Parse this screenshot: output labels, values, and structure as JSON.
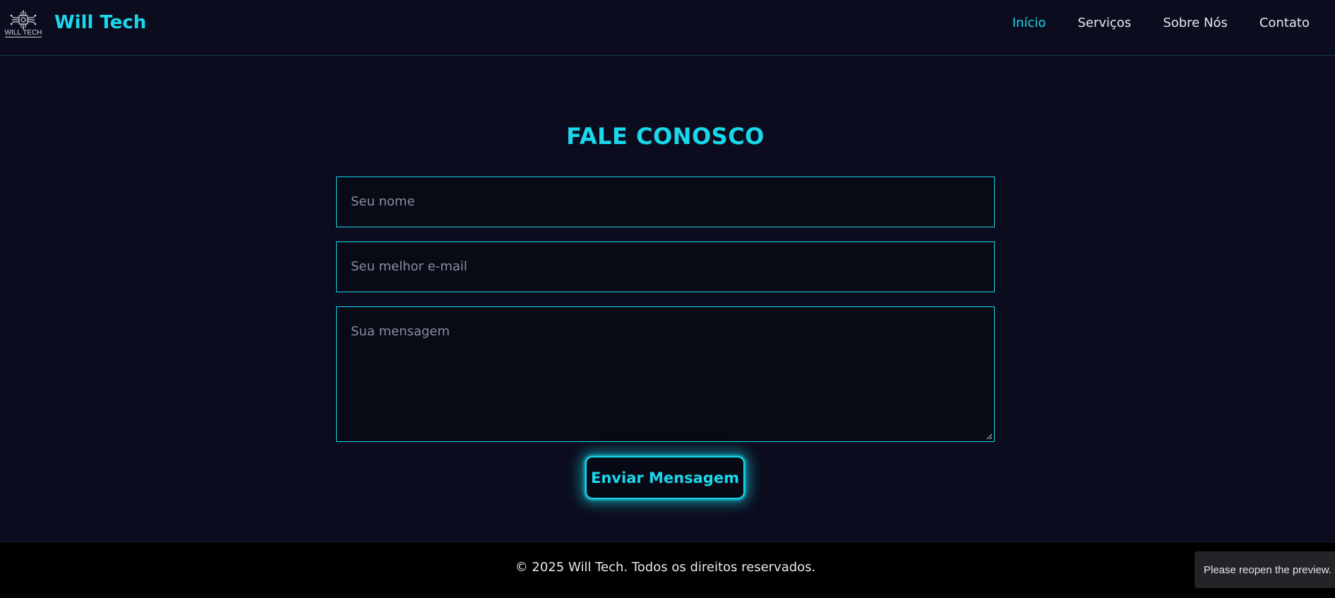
{
  "header": {
    "logo_text": "WILL TECH",
    "brand": "Will Tech",
    "nav": [
      {
        "label": "Início",
        "active": true
      },
      {
        "label": "Serviços",
        "active": false
      },
      {
        "label": "Sobre Nós",
        "active": false
      },
      {
        "label": "Contato",
        "active": false
      }
    ]
  },
  "contact": {
    "title": "FALE CONOSCO",
    "name_placeholder": "Seu nome",
    "email_placeholder": "Seu melhor e-mail",
    "message_placeholder": "Sua mensagem",
    "submit_label": "Enviar Mensagem"
  },
  "footer": {
    "text": "© 2025 Will Tech. Todos os direitos reservados."
  },
  "toast": {
    "text": "Please reopen the preview."
  },
  "colors": {
    "accent": "#1ad8ec",
    "background": "#0b0d1e",
    "footer_bg": "#000000"
  }
}
